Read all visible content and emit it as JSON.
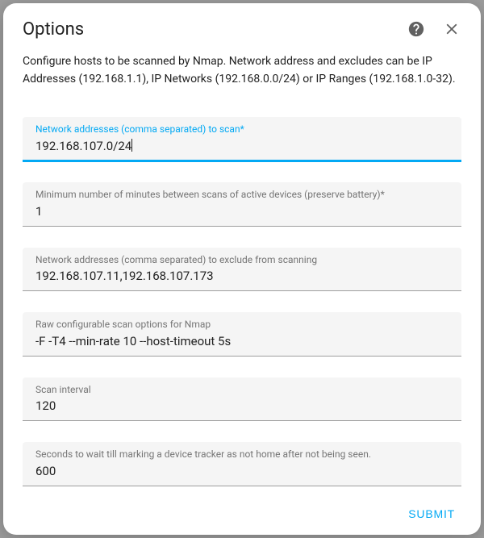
{
  "dialog": {
    "title": "Options",
    "description": "Configure hosts to be scanned by Nmap. Network address and excludes can be IP Addresses (192.168.1.1), IP Networks (192.168.0.0/24) or IP Ranges (192.168.1.0-32)."
  },
  "fields": {
    "hosts": {
      "label": "Network addresses (comma separated) to scan*",
      "value": "192.168.107.0/24"
    },
    "interval_min": {
      "label": "Minimum number of minutes between scans of active devices (preserve battery)*",
      "value": "1"
    },
    "exclude": {
      "label": "Network addresses (comma separated) to exclude from scanning",
      "value": "192.168.107.11,192.168.107.173"
    },
    "options": {
      "label": "Raw configurable scan options for Nmap",
      "value": "-F -T4 --min-rate 10 --host-timeout 5s"
    },
    "scan_sec": {
      "label": "Scan interval",
      "value": "120"
    },
    "consider_home": {
      "label": "Seconds to wait till marking a device tracker as not home after not being seen.",
      "value": "600"
    }
  },
  "actions": {
    "submit": "Submit"
  }
}
